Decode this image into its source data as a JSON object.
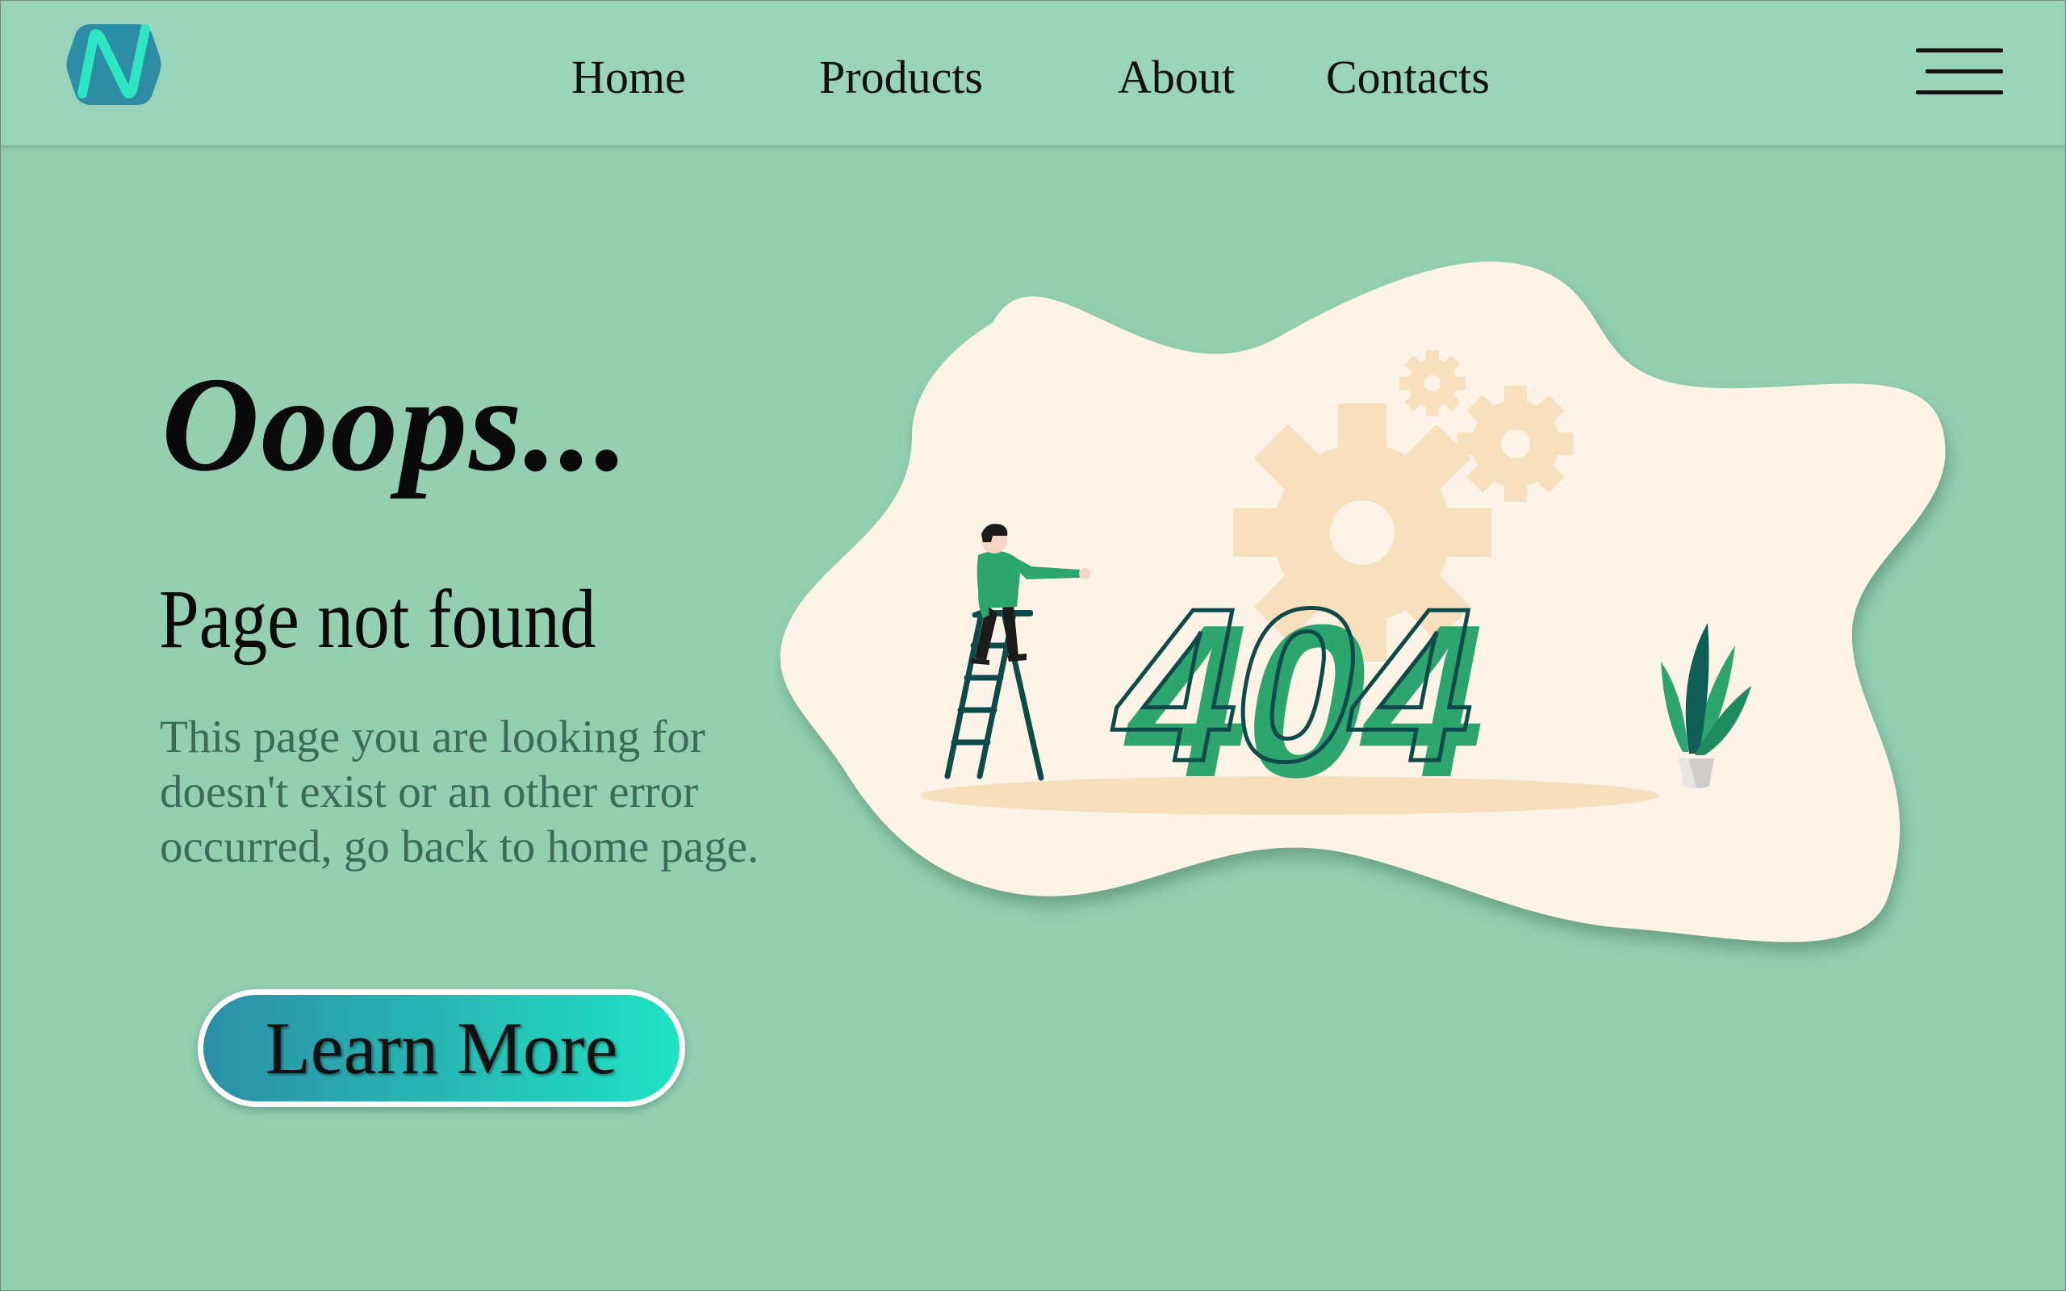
{
  "header": {
    "nav": {
      "home": "Home",
      "products": "Products",
      "about": "About",
      "contacts": "Contacts"
    }
  },
  "main": {
    "title": "Ooops...",
    "subtitle": "Page not found",
    "description": "This page you are looking for doesn't exist or an other error occurred, go back to home page.",
    "cta_label": "Learn More"
  },
  "illustration": {
    "error_code": "404"
  },
  "icons": {
    "logo": "logo-icon",
    "menu": "hamburger-menu-icon"
  },
  "colors": {
    "background": "#94cfb2",
    "header": "#99d4ba",
    "blob": "#fdf4e7",
    "accent_green": "#2da56e",
    "outline": "#0f4a4a",
    "gear": "#f7ddb9",
    "cta_start": "#2c8fa7",
    "cta_end": "#1fe2c4"
  }
}
